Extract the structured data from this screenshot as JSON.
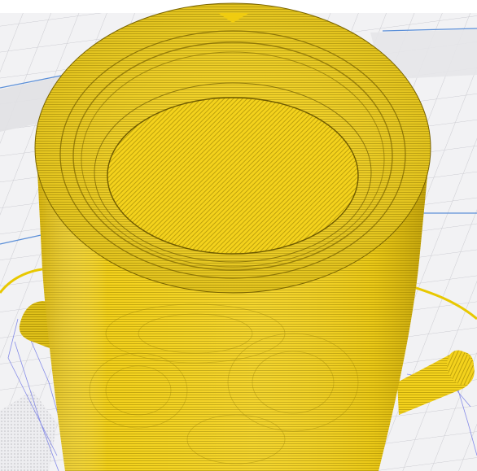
{
  "viewer": {
    "view_mode": "layer-preview",
    "colors": {
      "background": "#f4f4f6",
      "build_plate": "#f0f0f2",
      "plate_grid": "#c6c6cc",
      "plate_edge": "#5a8fd6",
      "model": "#f2d21a",
      "model_shadow": "#d9b400",
      "model_line": "#6e5a00",
      "travel_lines": "#7a7fe0",
      "support_shadow": "#c8c8cc"
    }
  }
}
